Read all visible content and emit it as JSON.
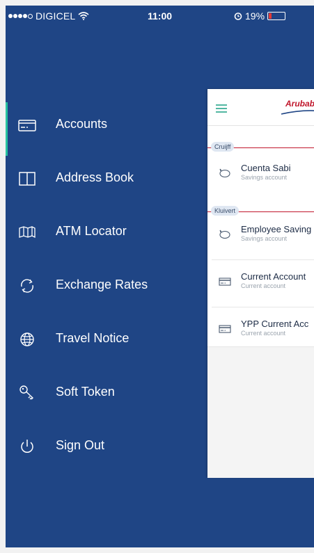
{
  "status_bar": {
    "carrier": "DIGICEL",
    "time": "11:00",
    "battery_percent": "19%",
    "battery_level": 0.19,
    "signal_bars_filled": 4,
    "signal_bars_total": 5
  },
  "menu": {
    "items": [
      {
        "label": "Accounts",
        "icon": "card-icon",
        "active": true
      },
      {
        "label": "Address Book",
        "icon": "book-icon"
      },
      {
        "label": "ATM Locator",
        "icon": "map-icon"
      },
      {
        "label": "Exchange Rates",
        "icon": "refresh-icon"
      },
      {
        "label": "Travel Notice",
        "icon": "globe-icon"
      },
      {
        "label": "Soft Token",
        "icon": "key-icon"
      },
      {
        "label": "Sign Out",
        "icon": "power-icon"
      }
    ]
  },
  "panel": {
    "logo_text": "Arubab",
    "groups": [
      {
        "name": "Cruijff",
        "accounts": [
          {
            "name": "Cuenta Sabi",
            "type": "Savings account",
            "icon": "piggy-bank-icon"
          }
        ]
      },
      {
        "name": "Kluivert",
        "accounts": [
          {
            "name": "Employee Saving",
            "type": "Savings account",
            "icon": "piggy-bank-icon"
          },
          {
            "name": "Current Account",
            "type": "Current account",
            "icon": "card-icon"
          },
          {
            "name": "YPP Current Acc",
            "type": "Current account",
            "icon": "card-icon"
          }
        ]
      }
    ]
  },
  "colors": {
    "menu_background": "#1f4585",
    "active_indicator": "#27c2a0",
    "brand_red": "#c0162b",
    "hamburger": "#27a58a"
  }
}
